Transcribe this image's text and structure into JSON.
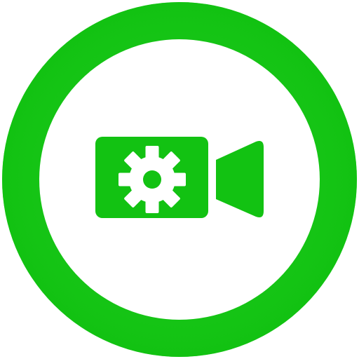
{
  "icon": {
    "name": "video-settings-icon",
    "parts": [
      "ring",
      "camera-body",
      "gear-icon",
      "camera-lens"
    ],
    "colors": {
      "ring": "#12c212",
      "ring_highlight": "#2fd82f",
      "inner_background": "#ffffff",
      "glyph": "#12c212",
      "gear": "#ffffff"
    }
  }
}
